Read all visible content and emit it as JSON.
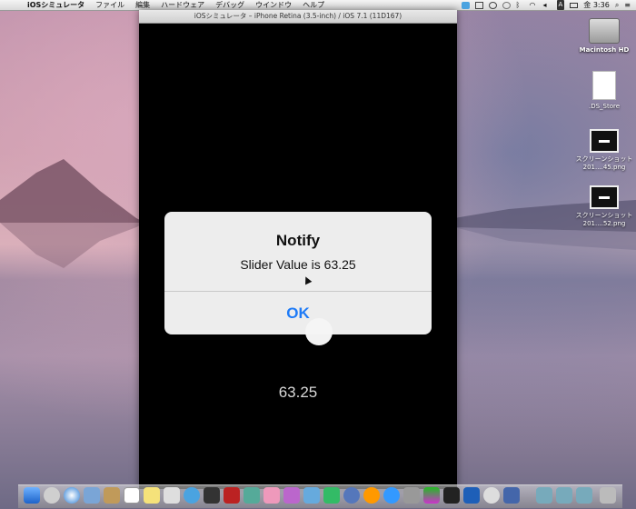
{
  "menubar": {
    "apple": "",
    "app_name": "iOSシミュレータ",
    "items": [
      "ファイル",
      "編集",
      "ハードウェア",
      "デバッグ",
      "ウインドウ",
      "ヘルプ"
    ],
    "status": {
      "ime": "A",
      "clock": "金 3:36"
    }
  },
  "simulator": {
    "title": "iOSシミュレータ – iPhone Retina (3.5-inch) / iOS 7.1 (11D167)",
    "value_label": "63.25",
    "slider_value": 63.25
  },
  "alert": {
    "title": "Notify",
    "message": "Slider Value is 63.25",
    "button": "OK",
    "button_color": "#1e7bf7"
  },
  "desktop": {
    "icons": [
      {
        "name": "Macintosh HD"
      },
      {
        "name": ".DS_Store"
      },
      {
        "name": "スクリーンショット 201....45.png"
      },
      {
        "name": "スクリーンショット 201....52.png"
      }
    ]
  }
}
